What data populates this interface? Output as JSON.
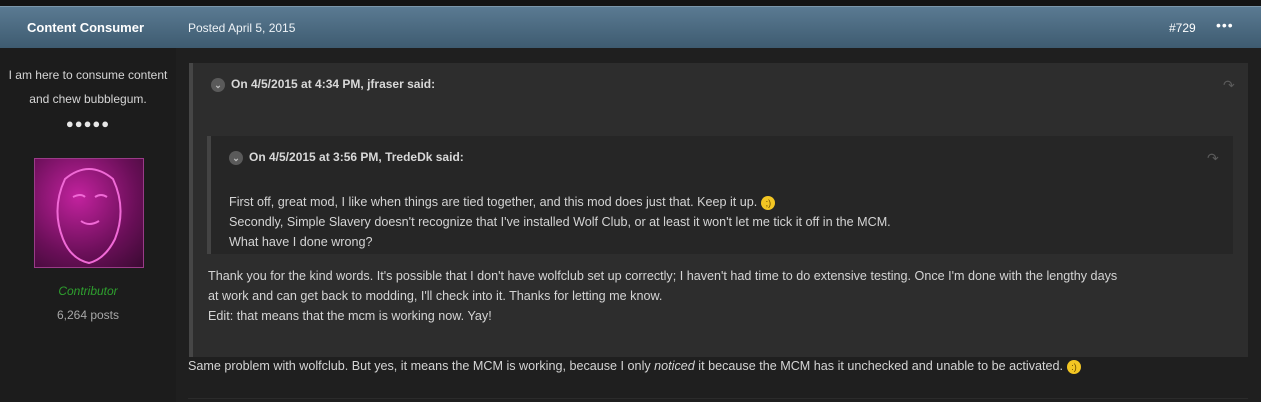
{
  "header": {
    "author": "Content Consumer",
    "posted": "Posted April 5, 2015",
    "post_number": "#729",
    "more_icon": "•••"
  },
  "sidebar": {
    "title_line1": "I am here to consume content",
    "title_line2": "and chew bubblegum.",
    "pips": "●●●●●",
    "group": "Contributor",
    "post_count": "6,264 posts"
  },
  "quote_outer": {
    "header": "On 4/5/2015 at 4:34 PM, jfraser said:",
    "body_line1": "Thank you for the kind words. It's possible that I don't have wolfclub set up correctly; I haven't had time to do extensive testing. Once I'm done with the lengthy days",
    "body_line2": "at work and can get back to modding, I'll check into it. Thanks for letting me know.",
    "body_line3": "Edit: that means that the mcm is working now. Yay!"
  },
  "quote_inner": {
    "header": "On 4/5/2015 at 3:56 PM, TredeDk said:",
    "line1": "First off, great mod, I like when things are tied together, and this mod does just that. Keep it up.",
    "line2": "Secondly, Simple Slavery doesn't recognize that I've installed Wolf Club, or at least it won't let me tick it off in the MCM.",
    "line3": "What have I done wrong?"
  },
  "main_body": {
    "part1": "Same problem with wolfclub. But yes, it means the MCM is working, because I only ",
    "italic": "noticed",
    "part2": " it because the MCM has it unchecked and unable to be activated."
  },
  "icons": {
    "chevron": "⌄",
    "share": "↷",
    "wink_emoji": ";)",
    "smile_emoji": ":)"
  }
}
